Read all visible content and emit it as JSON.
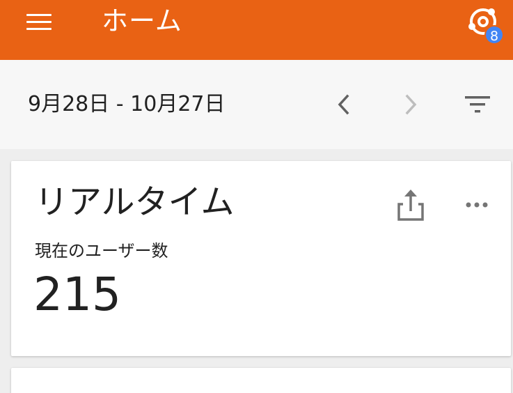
{
  "appbar": {
    "title": "ホーム",
    "menu_icon": "hamburger-menu-icon",
    "insights_icon": "insights-icon",
    "insights_badge": "8",
    "background": "#e96214"
  },
  "datebar": {
    "range": "9月28日 - 10月27日",
    "prev_icon": "chevron-left-icon",
    "next_icon": "chevron-right-icon",
    "filter_icon": "filter-icon"
  },
  "realtime_card": {
    "title": "リアルタイム",
    "share_icon": "share-icon",
    "more_icon": "more-horizontal-icon",
    "metric_label": "現在のユーザー数",
    "metric_value": "215"
  },
  "colors": {
    "accent": "#e96214",
    "badge": "#4285f4",
    "text": "#212121",
    "icon_gray": "#757575",
    "icon_disabled": "#bdbdbd"
  }
}
